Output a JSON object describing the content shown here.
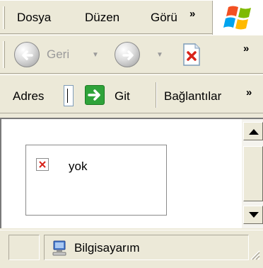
{
  "menubar": {
    "items": [
      {
        "label": "Dosya"
      },
      {
        "label": "Düzen"
      },
      {
        "label": "Görü"
      }
    ],
    "overflow_label": "»"
  },
  "toolbar": {
    "back_label": "Geri",
    "overflow_label": "»"
  },
  "address_bar": {
    "address_label": "Adres",
    "go_label": "Git",
    "links_label": "Bağlantılar",
    "overflow_label": "»"
  },
  "content": {
    "image_alt_text": "yok"
  },
  "statusbar": {
    "zone_label": "Bilgisayarım"
  },
  "colors": {
    "chrome": "#ece9d8",
    "go_green": "#2fa33a",
    "stop_red": "#d8231a"
  }
}
